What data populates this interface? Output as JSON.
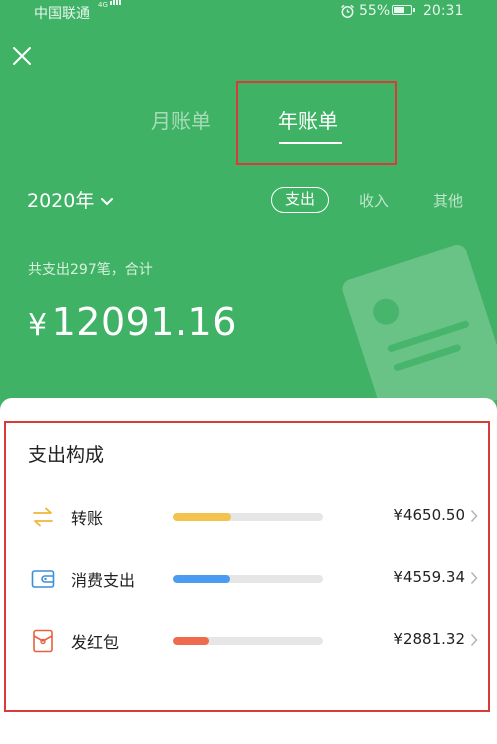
{
  "status_bar": {
    "carrier": "中国联通",
    "network_tag": "4G",
    "battery": "55%",
    "time": "20:31"
  },
  "tabs": [
    {
      "label": "月账单",
      "active": false
    },
    {
      "label": "年账单",
      "active": true
    }
  ],
  "year_selector": {
    "label": "2020年"
  },
  "filters": {
    "expense": "支出",
    "income": "收入",
    "other": "其他",
    "selected": "expense"
  },
  "summary": {
    "text": "共支出297笔，合计",
    "currency": "¥",
    "amount": "12091.16"
  },
  "breakdown": {
    "title": "支出构成",
    "items": [
      {
        "label": "转账",
        "amount": "¥4650.50",
        "share": 0.385,
        "color": "#f4c24f",
        "icon": "transfer-icon"
      },
      {
        "label": "消费支出",
        "amount": "¥4559.34",
        "share": 0.377,
        "color": "#4a9cf0",
        "icon": "wallet-icon"
      },
      {
        "label": "发红包",
        "amount": "¥2881.32",
        "share": 0.238,
        "color": "#ee6b4d",
        "icon": "red-envelope-icon"
      }
    ]
  },
  "colors": {
    "header_bg": "#3fb265",
    "highlight": "#d93a3a"
  }
}
